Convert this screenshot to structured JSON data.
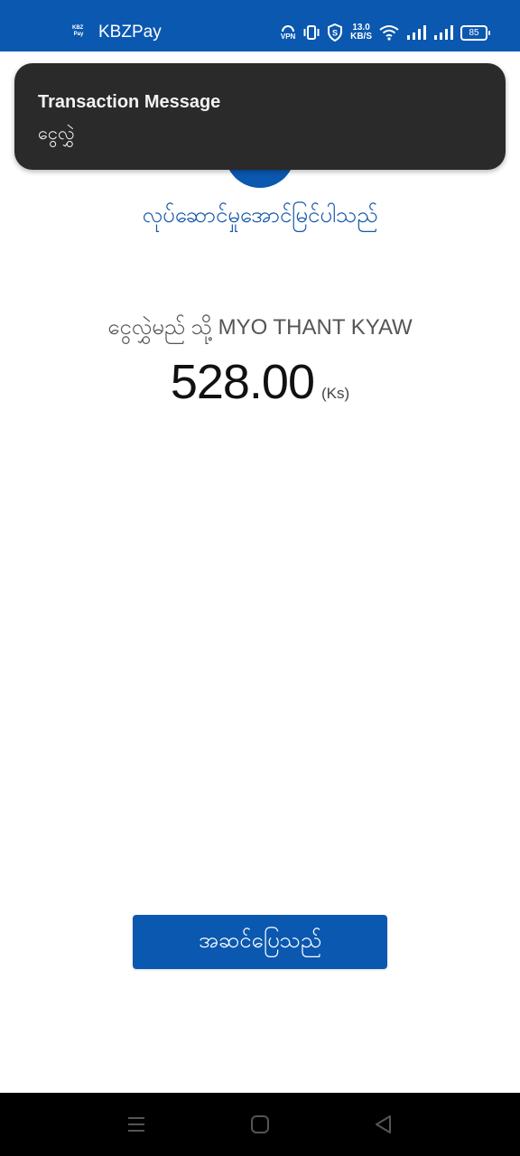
{
  "status_bar": {
    "app_logo": "KBZ Pay",
    "app_name": "KBZPay",
    "vpn_label": "VPN",
    "net_speed_value": "13.0",
    "net_speed_unit": "KB/S",
    "battery": "85",
    "icons": [
      "vpn-icon",
      "vibrate-icon",
      "shield-icon",
      "wifi-icon",
      "signal-icon",
      "signal-icon",
      "battery-icon"
    ]
  },
  "notification": {
    "title": "Transaction Message",
    "body": "ငွေလွှဲ"
  },
  "result": {
    "status_text": "လုပ်ဆောင်မှုအောင်မြင်ပါသည်",
    "recipient_line": "ငွေလွှဲမည် သို့ MYO THANT KYAW",
    "amount": "528.00",
    "currency": "(Ks)"
  },
  "actions": {
    "done_label": "အဆင်ပြေသည်"
  },
  "nav": {
    "icons": [
      "menu-icon",
      "home-icon",
      "back-icon"
    ]
  },
  "colors": {
    "brand_blue": "#0b58b0",
    "toast_bg": "#2a2a2a"
  }
}
